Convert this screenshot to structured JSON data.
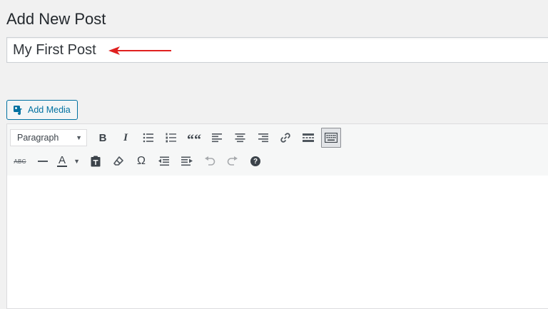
{
  "page": {
    "title": "Add New Post"
  },
  "post_title": {
    "value": "My First Post"
  },
  "media": {
    "add_media_label": "Add Media"
  },
  "toolbar": {
    "format_select": {
      "selected": "Paragraph"
    },
    "row1_icons": [
      "bold-icon",
      "italic-icon",
      "bulleted-list-icon",
      "numbered-list-icon",
      "blockquote-icon",
      "align-left-icon",
      "align-center-icon",
      "align-right-icon",
      "insert-link-icon",
      "read-more-icon",
      "toolbar-toggle-icon"
    ],
    "row2_icons": [
      "strikethrough-icon",
      "horizontal-line-icon",
      "text-color-icon",
      "paste-as-text-icon",
      "clear-formatting-icon",
      "special-character-icon",
      "decrease-indent-icon",
      "increase-indent-icon",
      "undo-icon",
      "redo-icon",
      "keyboard-shortcuts-icon"
    ],
    "row1_glyphs": {
      "bold": "B",
      "italic": "I",
      "blockquote": "““"
    },
    "row2_glyphs": {
      "strikethrough": "ABC",
      "text_color": "A",
      "omega": "Ω",
      "help": "?"
    }
  },
  "colors": {
    "accent": "#0071a1",
    "annotation_arrow": "#e0201f",
    "background": "#f1f1f1"
  }
}
